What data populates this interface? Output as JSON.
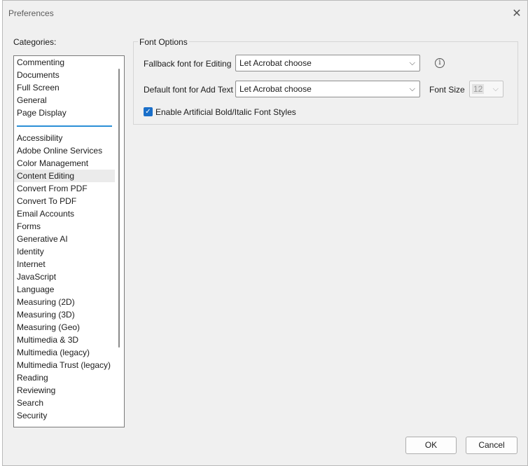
{
  "dialog": {
    "title": "Preferences"
  },
  "categories": {
    "label": "Categories:",
    "top_items": [
      "Commenting",
      "Documents",
      "Full Screen",
      "General",
      "Page Display"
    ],
    "items": [
      "Accessibility",
      "Adobe Online Services",
      "Color Management",
      "Content Editing",
      "Convert From PDF",
      "Convert To PDF",
      "Email Accounts",
      "Forms",
      "Generative AI",
      "Identity",
      "Internet",
      "JavaScript",
      "Language",
      "Measuring (2D)",
      "Measuring (3D)",
      "Measuring (Geo)",
      "Multimedia & 3D",
      "Multimedia (legacy)",
      "Multimedia Trust (legacy)",
      "Reading",
      "Reviewing",
      "Search",
      "Security"
    ],
    "selected": "Content Editing"
  },
  "font_options": {
    "group_label": "Font Options",
    "fallback_label": "Fallback font for Editing",
    "fallback_value": "Let Acrobat choose",
    "default_label": "Default font for Add Text",
    "default_value": "Let Acrobat choose",
    "size_label": "Font Size",
    "size_value": "12",
    "checkbox_label": "Enable Artificial Bold/Italic Font Styles",
    "checkbox_checked": true
  },
  "buttons": {
    "ok": "OK",
    "cancel": "Cancel"
  },
  "colors": {
    "accent": "#1a6fc9",
    "separator": "#2b8fd6"
  }
}
